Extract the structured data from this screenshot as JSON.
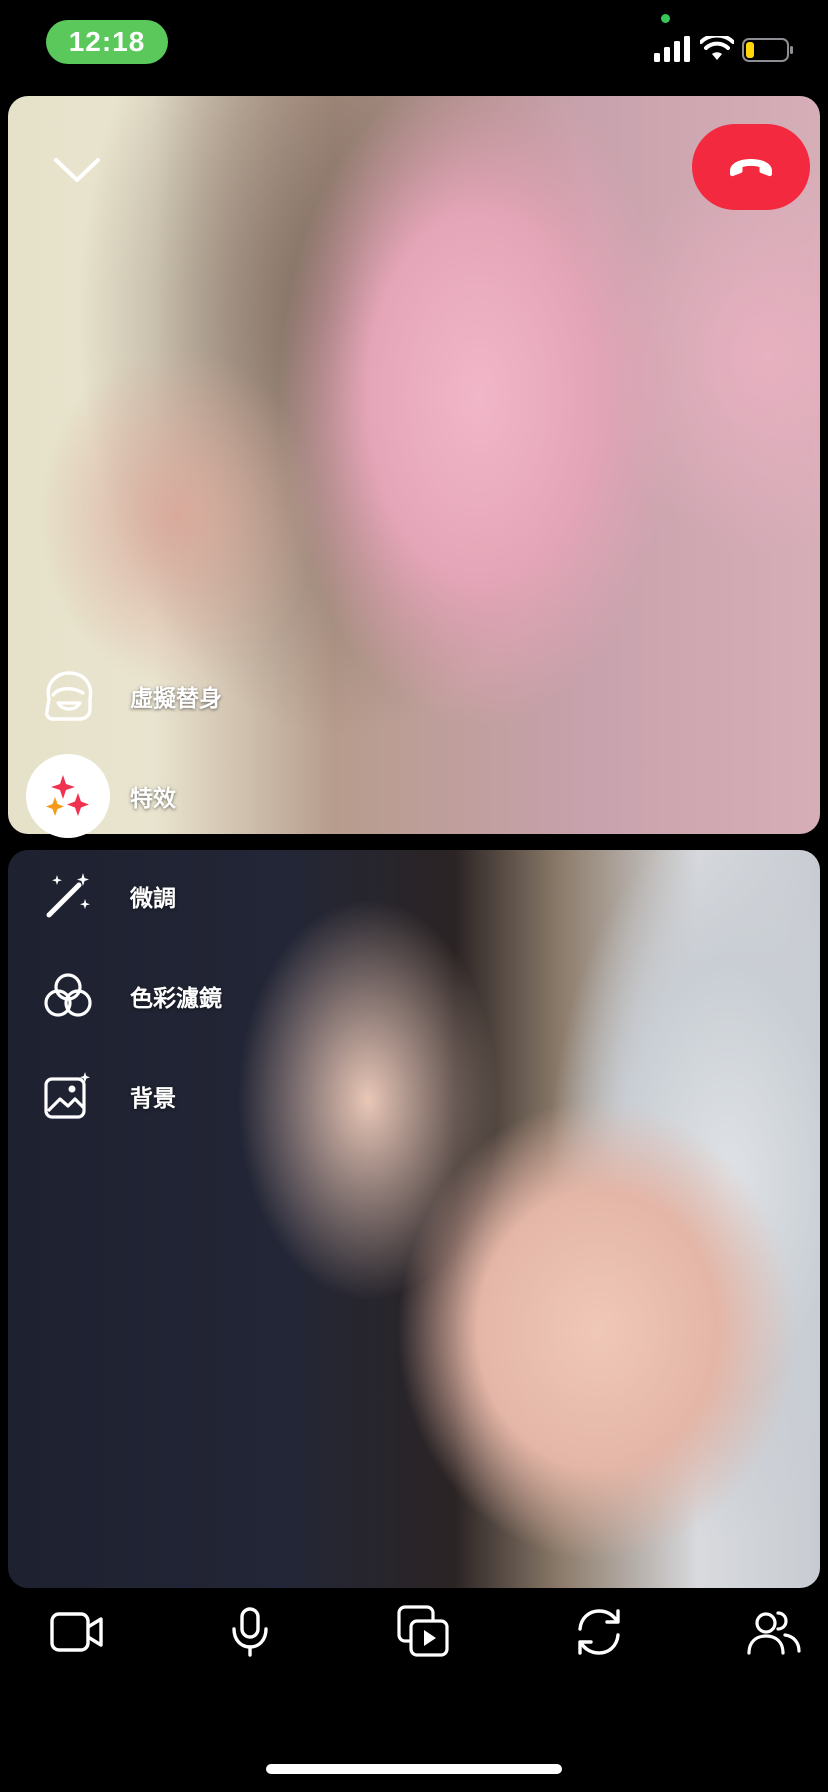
{
  "status_bar": {
    "time": "12:18",
    "time_pill_color": "#5ac85a",
    "icons": [
      "signal-icon",
      "wifi-icon",
      "battery-low-icon"
    ]
  },
  "call": {
    "minimize_icon": "chevron-down-icon",
    "end_call_icon": "phone-hangup-icon",
    "end_call_color": "#f2293f"
  },
  "menu": {
    "items": [
      {
        "label": "虛擬替身",
        "icon": "avatar-icon"
      },
      {
        "label": "特效",
        "icon": "sparkles-icon"
      },
      {
        "label": "微調",
        "icon": "magic-wand-icon"
      },
      {
        "label": "色彩濾鏡",
        "icon": "color-filter-icon"
      },
      {
        "label": "背景",
        "icon": "background-image-icon"
      }
    ]
  },
  "toolbar": {
    "items": [
      {
        "icon": "video-camera-icon"
      },
      {
        "icon": "microphone-icon"
      },
      {
        "icon": "media-share-icon"
      },
      {
        "icon": "flip-camera-icon"
      },
      {
        "icon": "participants-icon"
      }
    ]
  }
}
